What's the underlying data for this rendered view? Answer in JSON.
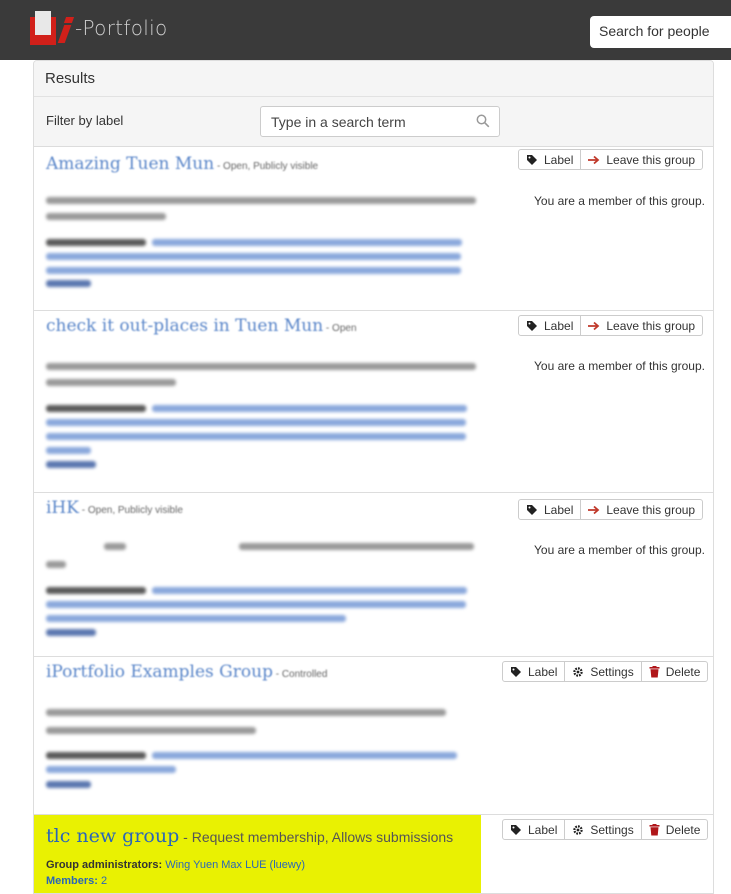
{
  "header": {
    "logo_text": "Portfolio",
    "search_placeholder": "Search for people"
  },
  "results": {
    "heading": "Results",
    "filter_label": "Filter by label",
    "filter_placeholder": "Type in a search term"
  },
  "groups": [
    {
      "title": "Amazing Tuen Mun",
      "subtitle": " - Open, Publicly visible",
      "actions": [
        "Label",
        "Leave this group"
      ],
      "member_note": "You are a member of this group."
    },
    {
      "title": "check it out-places in Tuen Mun",
      "subtitle": " - Open",
      "actions": [
        "Label",
        "Leave this group"
      ],
      "member_note": "You are a member of this group."
    },
    {
      "title": "iHK",
      "subtitle": " - Open, Publicly visible",
      "actions": [
        "Label",
        "Leave this group"
      ],
      "member_note": "You are a member of this group."
    },
    {
      "title": "iPortfolio Examples Group",
      "subtitle": " - Controlled",
      "actions": [
        "Label",
        "Settings",
        "Delete"
      ],
      "member_note": ""
    },
    {
      "title": "tlc new group",
      "subtitle": " - Request membership, Allows submissions",
      "actions": [
        "Label",
        "Settings",
        "Delete"
      ],
      "admin_label": "Group administrators:",
      "admin_value": "Wing Yuen Max LUE (luewy)",
      "members_label": "Members:",
      "members_value": "2"
    }
  ],
  "colors": {
    "topbar": "#3a3a3a",
    "brand_red": "#d1201a",
    "link_blue": "#2a66b8",
    "highlight": "#e9f102"
  }
}
